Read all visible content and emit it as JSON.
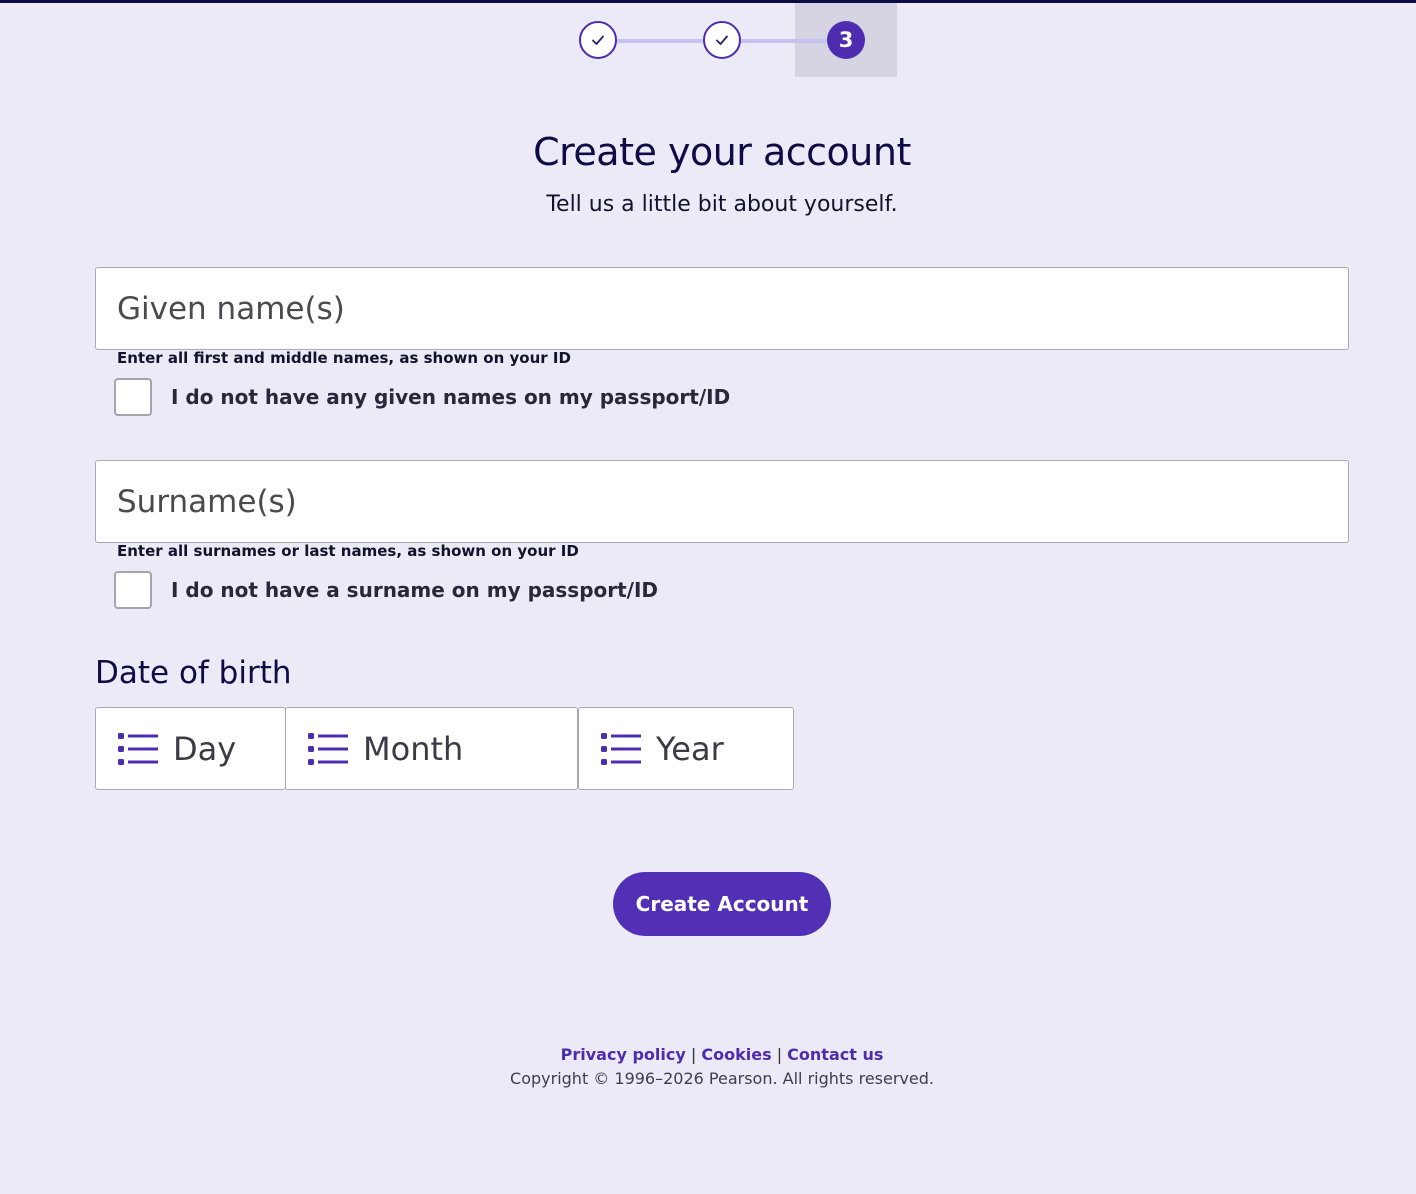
{
  "stepper": {
    "steps": [
      {
        "status": "complete",
        "icon": "check-icon"
      },
      {
        "status": "complete",
        "icon": "check-icon"
      },
      {
        "status": "current",
        "label": "3"
      }
    ]
  },
  "header": {
    "title": "Create your account",
    "subtitle": "Tell us a little bit about yourself."
  },
  "given_names": {
    "placeholder": "Given name(s)",
    "value": "",
    "helper": "Enter all first and middle names, as shown on your ID",
    "checkbox_label": "I do not have any given names on my passport/ID",
    "checkbox_checked": false
  },
  "surname": {
    "placeholder": "Surname(s)",
    "value": "",
    "helper": "Enter all surnames or last names, as shown on your ID",
    "checkbox_label": "I do not have a surname on my passport/ID",
    "checkbox_checked": false
  },
  "dob": {
    "title": "Date of birth",
    "day": "Day",
    "month": "Month",
    "year": "Year"
  },
  "submit_label": "Create Account",
  "footer": {
    "privacy": "Privacy policy",
    "cookies": "Cookies",
    "contact": "Contact us",
    "separator": "|",
    "copyright": "Copyright © 1996–2026 Pearson. All rights reserved."
  },
  "colors": {
    "background": "#ECEAF6",
    "accent": "#4E2CB0",
    "heading": "#0F0B45",
    "stepper_line": "#C4C2F0"
  }
}
